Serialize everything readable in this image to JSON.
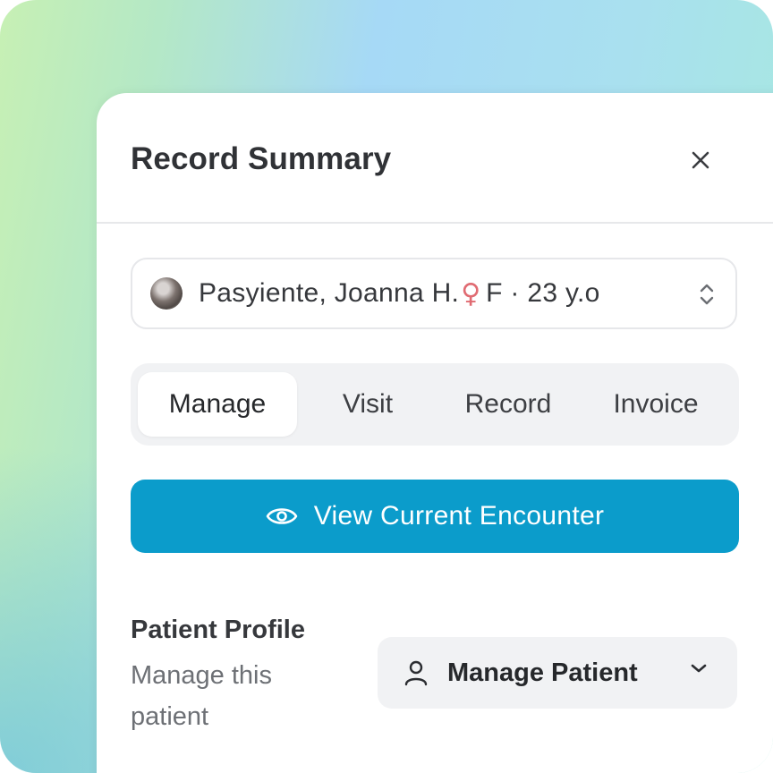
{
  "panel": {
    "title": "Record Summary"
  },
  "patient": {
    "name": "Pasyiente, Joanna H.",
    "gender_symbol": "♀",
    "meta": "F · 23 y.o"
  },
  "tabs": [
    {
      "label": "Manage",
      "active": true
    },
    {
      "label": "Visit",
      "active": false
    },
    {
      "label": "Record",
      "active": false
    },
    {
      "label": "Invoice",
      "active": false
    }
  ],
  "primary_action": {
    "label": "View Current Encounter",
    "icon": "eye-icon"
  },
  "profile": {
    "title": "Patient Profile",
    "description": "Manage this patient",
    "button_label": "Manage Patient"
  },
  "colors": {
    "primary": "#0b9ccb",
    "female": "#e06b72"
  }
}
